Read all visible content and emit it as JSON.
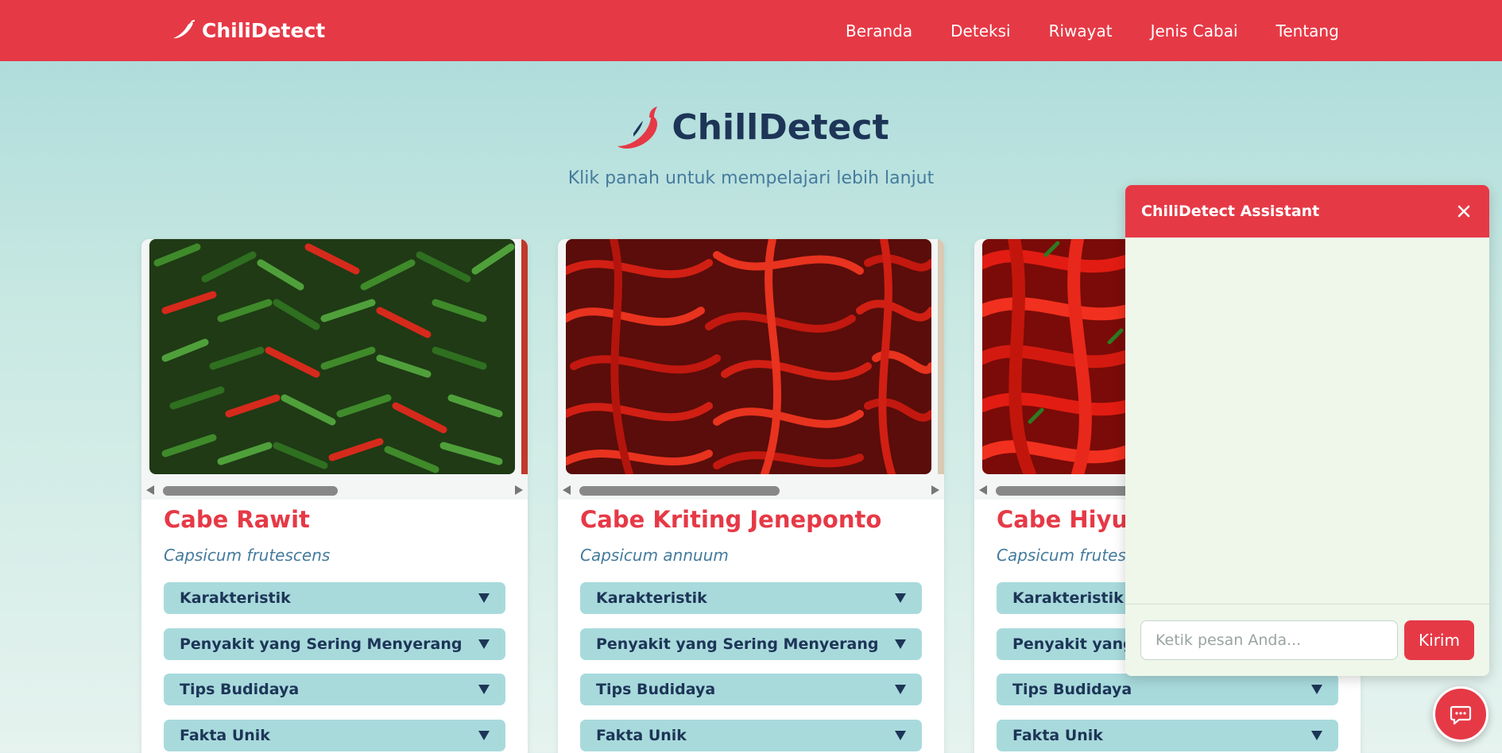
{
  "navbar": {
    "brand": "ChiliDetect",
    "links": [
      "Beranda",
      "Deteksi",
      "Riwayat",
      "Jenis Cabai",
      "Tentang"
    ]
  },
  "hero": {
    "title": "ChillDetect",
    "subtitle": "Klik panah untuk mempelajari lebih lanjut"
  },
  "accordion_labels": [
    "Karakteristik",
    "Penyakit yang Sering Menyerang",
    "Tips Budidaya",
    "Fakta Unik"
  ],
  "cards": [
    {
      "name": "Cabe Rawit",
      "latin": "Capsicum frutescens",
      "accordion": [
        "Karakteristik",
        "Penyakit yang Sering Menyerang",
        "Tips Budidaya",
        "Fakta Unik"
      ]
    },
    {
      "name": "Cabe Kriting Jeneponto",
      "latin": "Capsicum annuum",
      "accordion": [
        "Karakteristik",
        "Penyakit yang Sering Menyerang",
        "Tips Budidaya",
        "Fakta Unik"
      ]
    },
    {
      "name": "Cabe Hiyung",
      "latin": "Capsicum frutescens",
      "accordion": [
        "Karakteristik",
        "Penyakit yang Sering Menyerang",
        "Tips Budidaya",
        "Fakta Unik"
      ]
    }
  ],
  "chat": {
    "title": "ChiliDetect Assistant",
    "input_placeholder": "Ketik pesan Anda...",
    "send_label": "Kirim"
  },
  "colors": {
    "primary": "#e63946",
    "navy": "#1d3557",
    "teal_light": "#a8dadc",
    "accent_blue": "#457b9d"
  },
  "icons": {
    "brand": "chili-icon",
    "hero": "chili-pepper-icon",
    "chat_close": "close-icon",
    "fab": "chat-bubble-icon"
  }
}
